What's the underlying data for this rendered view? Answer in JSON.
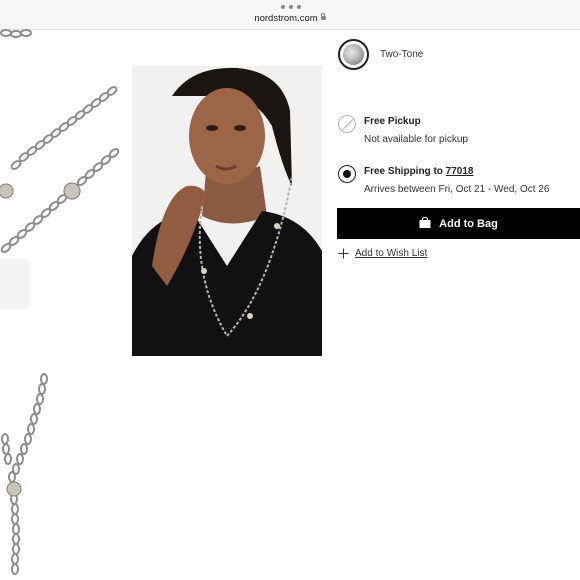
{
  "browser": {
    "url": "nordstrom.com",
    "icons": {
      "menu": "more-dots-icon",
      "lock": "lock-icon"
    }
  },
  "gallery": {
    "thumbnails": [
      "chain-closeup-image",
      "chain-pendant-image"
    ],
    "main_image": "model-wearing-necklace-image"
  },
  "product": {
    "color_swatch": {
      "label": "Two-Tone",
      "icon": "swatch-thumbnail"
    },
    "delivery": {
      "pickup": {
        "title": "Free Pickup",
        "subtitle": "Not available for pickup",
        "state": "disabled"
      },
      "shipping": {
        "title_prefix": "Free Shipping to ",
        "zip": "77018",
        "subtitle": "Arrives between Fri, Oct 21 - Wed, Oct 26",
        "state": "selected"
      }
    },
    "add_to_bag_label": "Add to Bag",
    "wish_list_label": "Add to Wish List"
  },
  "colors": {
    "button_bg": "#000000",
    "button_text": "#ffffff",
    "text": "#222222",
    "browser_bar": "#f7f7f7"
  }
}
